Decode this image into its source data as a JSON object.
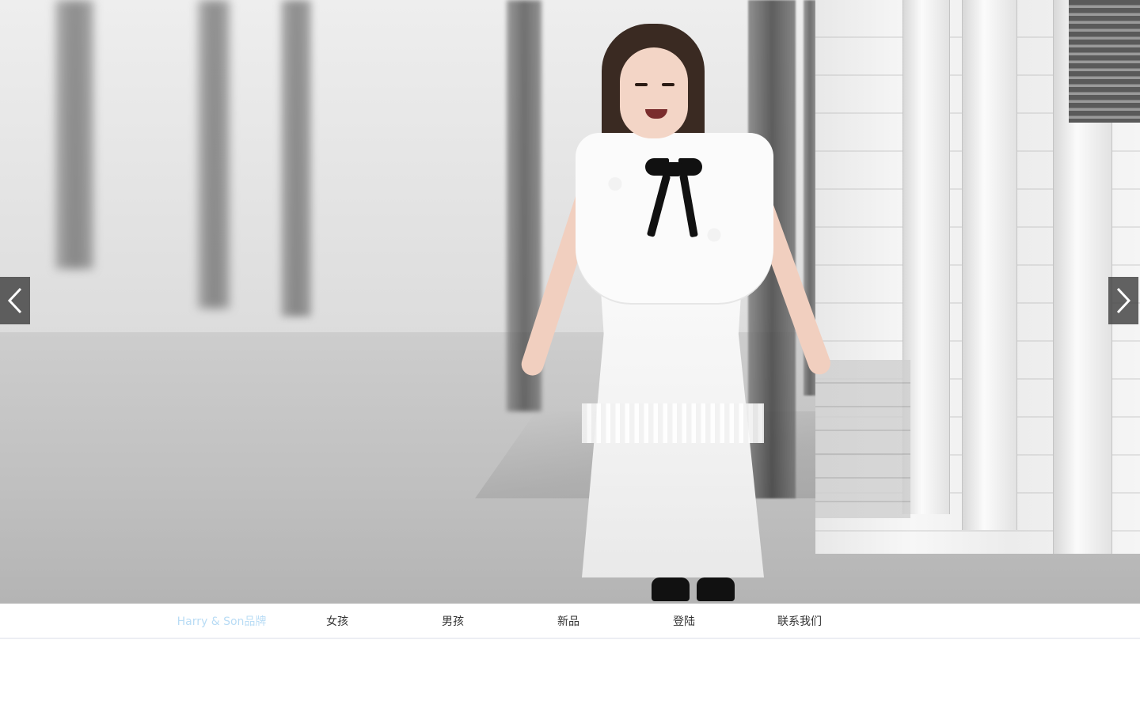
{
  "hero": {
    "image_alt": "girl in white lace dress running on street",
    "prev_icon": "chevron-left-icon",
    "next_icon": "chevron-right-icon"
  },
  "nav": {
    "items": [
      {
        "label": "Harry & Son品牌",
        "active": true
      },
      {
        "label": "女孩"
      },
      {
        "label": "男孩"
      },
      {
        "label": "新品"
      },
      {
        "label": "登陆"
      },
      {
        "label": "联系我们"
      }
    ],
    "active_color": "#b9dcf5",
    "text_color": "#333333"
  }
}
